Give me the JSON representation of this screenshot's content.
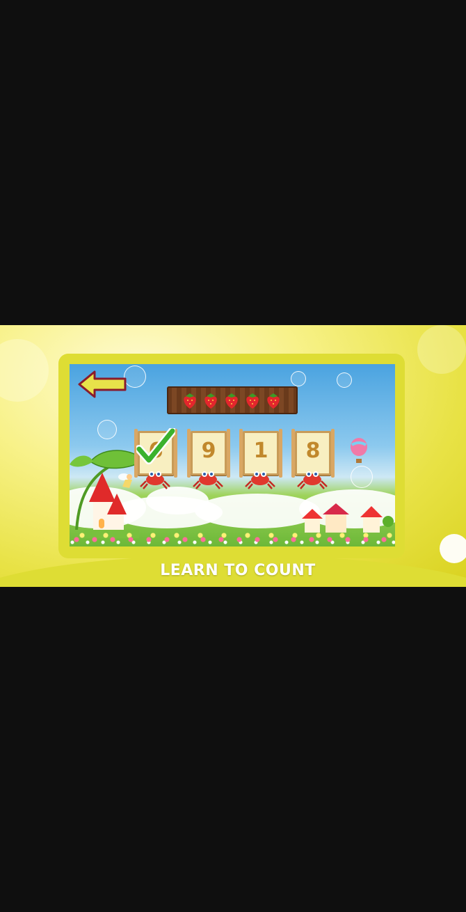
{
  "game": {
    "title": "LEARN TO COUNT",
    "prompt_item": "strawberry",
    "prompt_count": 5,
    "options": [
      {
        "number": "6",
        "checked": true
      },
      {
        "number": "9",
        "checked": false
      },
      {
        "number": "1",
        "checked": false
      },
      {
        "number": "8",
        "checked": false
      }
    ]
  },
  "icons": {
    "back": "back-arrow-icon",
    "check": "check-icon",
    "strawberry": "strawberry-icon",
    "crab": "crab-icon"
  },
  "colors": {
    "frame": "#dedd34",
    "card_text": "#c1882c",
    "check": "#3bb22d",
    "arrow": "#e8e24a"
  }
}
